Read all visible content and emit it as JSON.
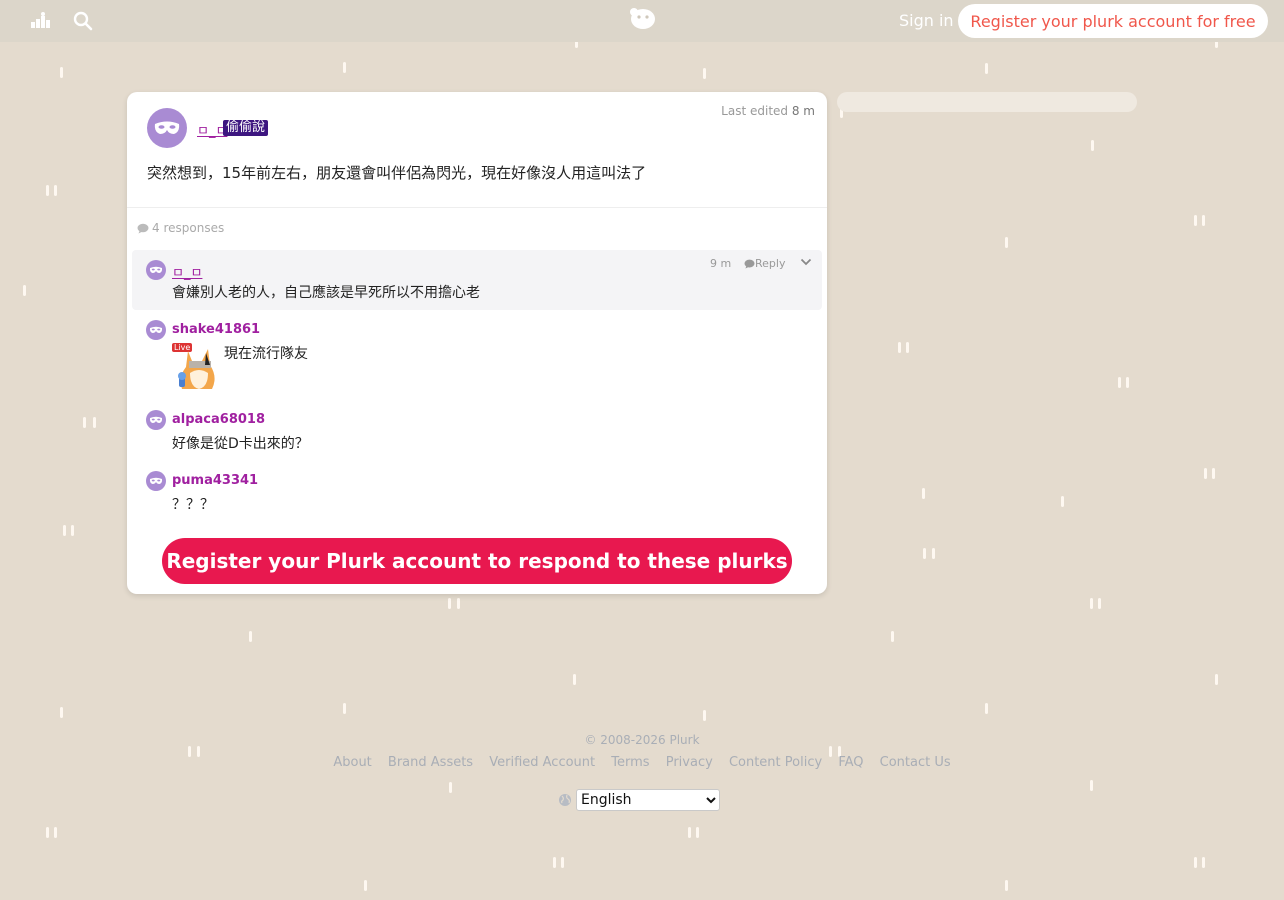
{
  "topbar": {
    "signin_label": "Sign in",
    "register_label": "Register your plurk account for free"
  },
  "plurk": {
    "author": "ㅁ_ㅁ",
    "qualifier": "偷偷說",
    "last_edited_label": "Last edited",
    "last_edited_time": "8 m",
    "content": "突然想到，15年前左右，朋友還會叫伴侶為閃光，現在好像沒人用這叫法了",
    "responses_label": "4 responses"
  },
  "responses": [
    {
      "name": "ㅁ_ㅁ",
      "text": "會嫌別人老的人，自己應該是早死所以不用擔心老",
      "time": "9 m",
      "reply_label": "Reply"
    },
    {
      "name": "shake41861",
      "text": "現在流行隊友",
      "sticker_badge": "Live"
    },
    {
      "name": "alpaca68018",
      "text": "好像是從D卡出來的？"
    },
    {
      "name": "puma43341",
      "text": "？？？"
    }
  ],
  "cta": {
    "label": "Register your Plurk account to respond to these plurks"
  },
  "footer": {
    "copyright": "© 2008-2026 Plurk",
    "links": [
      "About",
      "Brand Assets",
      "Verified Account",
      "Terms",
      "Privacy",
      "Content Policy",
      "FAQ",
      "Contact Us"
    ],
    "language_selected": "English"
  },
  "colors": {
    "background": "#e4dbce",
    "accent_red": "#e8184f",
    "qualifier_bg": "#3d1680",
    "username": "#a020a0"
  }
}
